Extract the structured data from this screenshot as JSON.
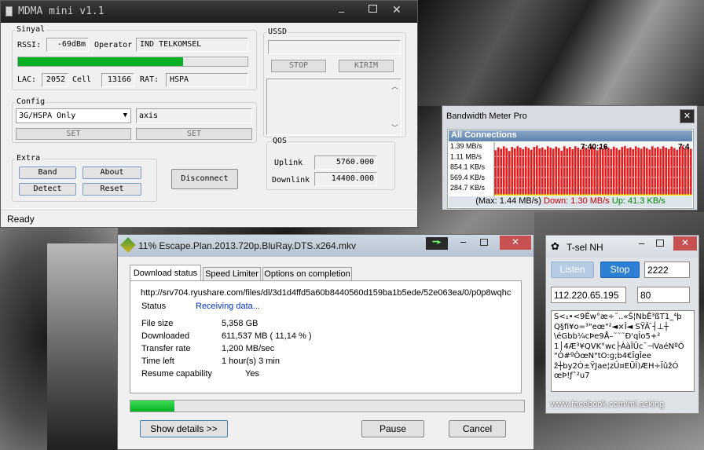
{
  "mdma": {
    "title": "MDMA mini v1.1",
    "status_bar": "Ready",
    "sinyal": {
      "legend": "Sinyal",
      "rssi_label": "RSSI:",
      "rssi_value": "-69dBm",
      "operator_label": "Operator",
      "operator_value": "IND TELKOMSEL",
      "signal_level": 0.72,
      "lac_label": "LAC:",
      "lac_value": "2052",
      "cell_label": "Cell",
      "cell_value": "13166",
      "rat_label": "RAT:",
      "rat_value": "HSPA"
    },
    "config": {
      "legend": "Config",
      "mode_selected": "3G/HSPA Only",
      "apn_value": "axis",
      "set_label_1": "SET",
      "set_label_2": "SET"
    },
    "extra": {
      "legend": "Extra",
      "band": "Band",
      "about": "About",
      "detect": "Detect",
      "reset": "Reset"
    },
    "disconnect": "Disconnect",
    "ussd": {
      "legend": "USSD",
      "stop": "STOP",
      "kirim": "KIRIM"
    },
    "qos": {
      "legend": "QOS",
      "uplink_label": "Uplink",
      "uplink_value": "5760.000",
      "downlink_label": "Downlink",
      "downlink_value": "14400.000"
    }
  },
  "bandwidth": {
    "title": "Bandwidth Meter Pro",
    "close": "✕",
    "header": "All Connections",
    "y_labels": [
      "1.39 MB/s",
      "1.11 MB/s",
      "854.1 KB/s",
      "569.4 KB/s",
      "284.7 KB/s"
    ],
    "time_label_1": "7:40:16",
    "time_label_2": "7:4",
    "footer_max": "(Max: 1.44 MB/s)",
    "footer_down": "Down: 1.30 MB/s",
    "footer_up": "Up: 41.3 KB/s",
    "colors": {
      "down": "#e02020",
      "up": "#e8e800",
      "label_down": "#cc0000",
      "label_up": "#008800"
    },
    "chart_data": {
      "type": "bar",
      "ylim": [
        0,
        1.44
      ],
      "ylabel_unit": "MB/s",
      "values": [
        1.24,
        1.32,
        1.28,
        1.35,
        1.3,
        1.22,
        1.33,
        1.29,
        1.36,
        1.31,
        1.27,
        1.34,
        1.3,
        1.25,
        1.33,
        1.37,
        1.29,
        1.32,
        1.26,
        1.35,
        1.31,
        1.28,
        1.34,
        1.3,
        1.23,
        1.36,
        1.29,
        1.33,
        1.27,
        1.35,
        1.31,
        1.26,
        1.34,
        1.3,
        1.28,
        1.36,
        1.32,
        1.24,
        1.33,
        1.29,
        1.35,
        1.31,
        1.27,
        1.34,
        1.3,
        1.25,
        1.33,
        1.36,
        1.29,
        1.32,
        1.27,
        1.35,
        1.31,
        1.28,
        1.34,
        1.3,
        1.26,
        1.36,
        1.3,
        1.33,
        1.28,
        1.35,
        1.31,
        1.27,
        1.34,
        1.3,
        1.25,
        1.33,
        1.36,
        1.29,
        1.32,
        1.28
      ]
    }
  },
  "tsel": {
    "title": "T-sel NH",
    "listen": "Listen",
    "stop": "Stop",
    "port_value": "2222",
    "ip_value": "112.220.65.195",
    "port2_value": "80",
    "log_text": "S<₁•<9Êw°æ÷˜..«Š¦NbÊ³ßT1_⁴ϸ\nQ§fi¥ο=³\"eœ\"²◄×Î◄ SŸÂ ̄┤⊥┼\n\\éGbb¼cÞe9Å–˜˜˜Ð'qÎo5+²\n1│4Æ³¥QVK°wc├ÀàÏÜc¯⊣VaéNºÓ\n\"Ò#ºÒœN\"tO:g;b4€ÎgÎee\nž┼by2Ò±ŸJae¦zÛ¤EÜÌ)ÆH÷ÏûžÓ\nœÞ!ƒˆ²u7",
    "footer": "www.facebook.com/ml.asking"
  },
  "download": {
    "title": "11% Escape.Plan.2013.720p.BluRay.DTS.x264.mkv",
    "tabs": [
      "Download status",
      "Speed Limiter",
      "Options on completion"
    ],
    "url": "http://srv704.ryushare.com/files/dl/3d1d4ffd5a60b8440560d159ba1b5ede/52e063ea/0/p0p8wqhc",
    "status_label": "Status",
    "status_value": "Receiving data...",
    "rows": [
      {
        "label": "File size",
        "value": "5,358  GB"
      },
      {
        "label": "Downloaded",
        "value": "611,537  MB  ( 11,14 % )"
      },
      {
        "label": "Transfer rate",
        "value": "1,200  MB/sec"
      },
      {
        "label": "Time left",
        "value": "1 hour(s) 3 min"
      },
      {
        "label": "Resume capability",
        "value": "Yes"
      }
    ],
    "progress": 0.1114,
    "show_details": "Show details >>",
    "pause": "Pause",
    "cancel": "Cancel",
    "colors": {
      "progress": "#06b025",
      "status_link": "#0033cc"
    }
  }
}
